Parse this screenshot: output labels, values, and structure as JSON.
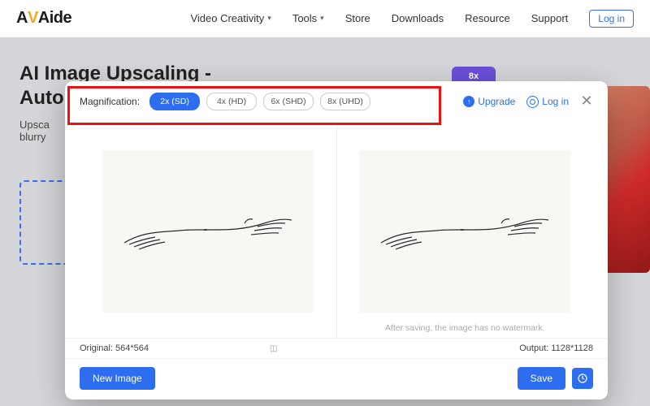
{
  "brand": {
    "part1": "A",
    "v": "V",
    "part2": "Aide"
  },
  "nav": {
    "items": [
      "Video Creativity",
      "Tools",
      "Store",
      "Downloads",
      "Resource",
      "Support"
    ],
    "login": "Log in"
  },
  "page": {
    "title": "AI Image Upscaling - Auto Enla",
    "desc": "Upsca\nblurry",
    "badge": "8x"
  },
  "modal": {
    "magnification_label": "Magnification:",
    "options": [
      {
        "label": "2x (SD)",
        "active": true
      },
      {
        "label": "4x (HD)",
        "active": false
      },
      {
        "label": "6x (SHD)",
        "active": false
      },
      {
        "label": "8x (UHD)",
        "active": false
      }
    ],
    "upgrade": "Upgrade",
    "login": "Log in",
    "watermark_note": "After saving, the image has no watermark.",
    "original_label": "Original: 564*564",
    "output_label": "Output: 1128*1128",
    "new_image": "New Image",
    "save": "Save"
  }
}
